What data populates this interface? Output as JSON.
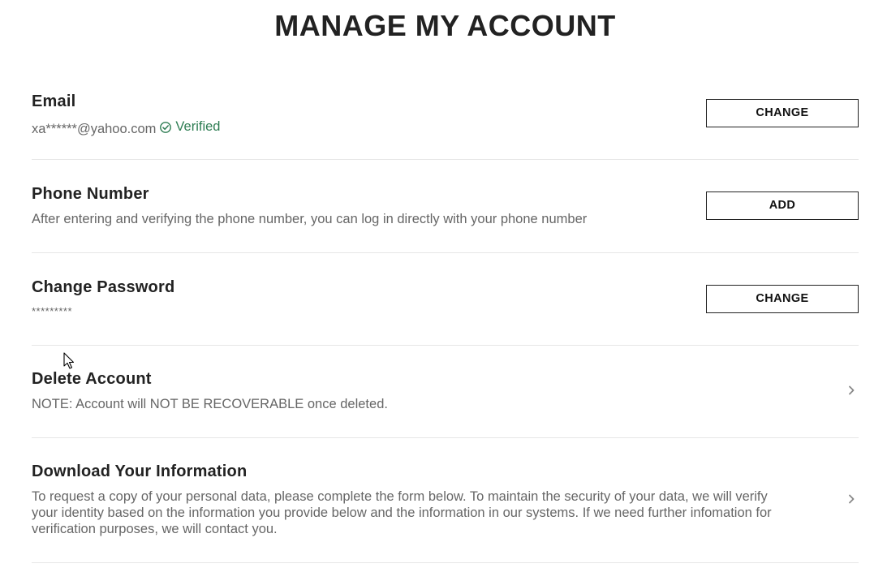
{
  "page": {
    "title": "MANAGE MY ACCOUNT"
  },
  "email": {
    "title": "Email",
    "value": "xa******@yahoo.com",
    "status": "Verified",
    "status_icon": "check-circle-icon",
    "button_label": "CHANGE"
  },
  "phone": {
    "title": "Phone Number",
    "description": "After entering and verifying the phone number, you can log in directly with your phone number",
    "button_label": "ADD"
  },
  "password": {
    "title": "Change Password",
    "value": "*********",
    "button_label": "CHANGE"
  },
  "delete_account": {
    "title": "Delete Account",
    "description": "NOTE: Account will NOT BE RECOVERABLE once deleted.",
    "icon": "chevron-right-icon"
  },
  "download_info": {
    "title": "Download Your Information",
    "description_lines": [
      "To request a copy of your personal data, please complete the form below. To maintain the security of your data, we will verify",
      "your identity based on the information you provide below and the information in our systems. If we need further infomation for",
      "verification purposes, we will contact you."
    ],
    "icon": "chevron-right-icon"
  },
  "colors": {
    "verified": "#2e7d53",
    "text_muted": "#666666",
    "divider": "#e6e6e6"
  }
}
